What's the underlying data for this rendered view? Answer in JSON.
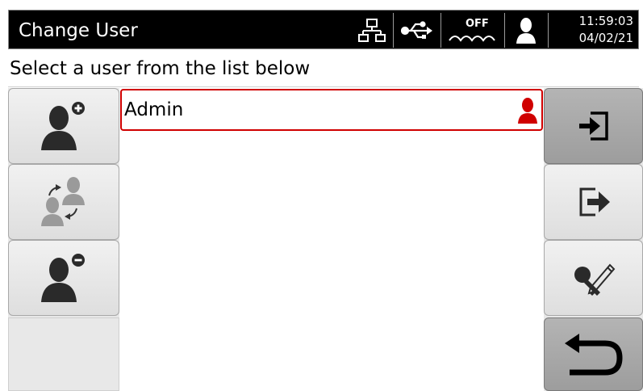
{
  "header": {
    "title": "Change User",
    "network_icon": "network-icon",
    "usb_icon": "usb-icon",
    "heater_status": "OFF",
    "heater_icon": "water-bath-icon",
    "user_icon": "user-icon",
    "time": "11:59:03",
    "date": "04/02/21"
  },
  "instruction": "Select a user from the list below",
  "left_buttons": [
    {
      "name": "add-user-button",
      "icon": "add-user-icon",
      "enabled": true
    },
    {
      "name": "switch-user-button",
      "icon": "switch-user-icon",
      "enabled": false
    },
    {
      "name": "remove-user-button",
      "icon": "remove-user-icon",
      "enabled": true
    }
  ],
  "right_buttons": [
    {
      "name": "login-button",
      "icon": "login-icon"
    },
    {
      "name": "logout-button",
      "icon": "logout-icon"
    },
    {
      "name": "change-password-button",
      "icon": "key-edit-icon"
    },
    {
      "name": "back-button",
      "icon": "back-arrow-icon"
    }
  ],
  "users": [
    {
      "name": "Admin",
      "icon": "admin-user-icon",
      "selected": true,
      "color": "#d00000"
    }
  ],
  "colors": {
    "selection": "#d00000",
    "header_bg": "#000000"
  }
}
